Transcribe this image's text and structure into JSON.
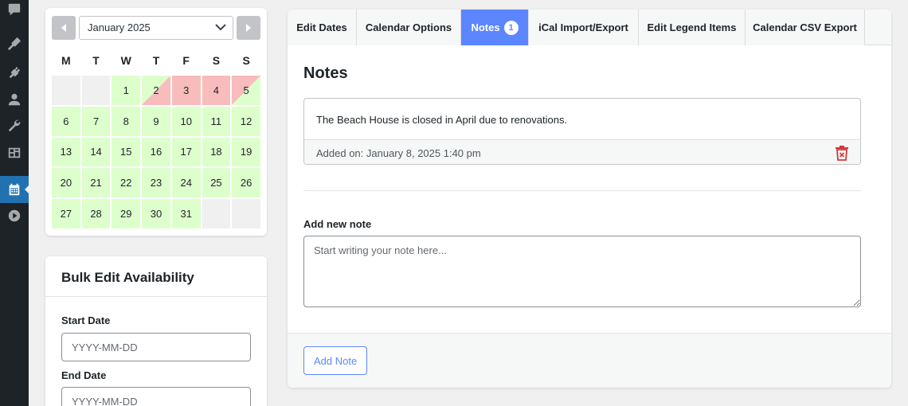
{
  "admin_menu": {
    "icons": [
      "comments-icon",
      "appearance-icon",
      "plugins-icon",
      "users-icon",
      "tools-icon",
      "settings-icon",
      "calendar-icon",
      "media-play-icon"
    ],
    "active": "calendar-icon"
  },
  "calendar": {
    "month_label": "January 2025",
    "weekdays": [
      "M",
      "T",
      "W",
      "T",
      "F",
      "S",
      "S"
    ],
    "days": [
      {
        "label": "",
        "status": "empty"
      },
      {
        "label": "",
        "status": "empty"
      },
      {
        "label": "1",
        "status": "available"
      },
      {
        "label": "2",
        "status": "changeover-in"
      },
      {
        "label": "3",
        "status": "booked"
      },
      {
        "label": "4",
        "status": "booked"
      },
      {
        "label": "5",
        "status": "changeover-out"
      },
      {
        "label": "6",
        "status": "available"
      },
      {
        "label": "7",
        "status": "available"
      },
      {
        "label": "8",
        "status": "available"
      },
      {
        "label": "9",
        "status": "available"
      },
      {
        "label": "10",
        "status": "available"
      },
      {
        "label": "11",
        "status": "available"
      },
      {
        "label": "12",
        "status": "available"
      },
      {
        "label": "13",
        "status": "available"
      },
      {
        "label": "14",
        "status": "available"
      },
      {
        "label": "15",
        "status": "available"
      },
      {
        "label": "16",
        "status": "available"
      },
      {
        "label": "17",
        "status": "available"
      },
      {
        "label": "18",
        "status": "available"
      },
      {
        "label": "19",
        "status": "available"
      },
      {
        "label": "20",
        "status": "available"
      },
      {
        "label": "21",
        "status": "available"
      },
      {
        "label": "22",
        "status": "available"
      },
      {
        "label": "23",
        "status": "available"
      },
      {
        "label": "24",
        "status": "available"
      },
      {
        "label": "25",
        "status": "available"
      },
      {
        "label": "26",
        "status": "available"
      },
      {
        "label": "27",
        "status": "available"
      },
      {
        "label": "28",
        "status": "available"
      },
      {
        "label": "29",
        "status": "available"
      },
      {
        "label": "30",
        "status": "available"
      },
      {
        "label": "31",
        "status": "available"
      },
      {
        "label": "",
        "status": "empty"
      },
      {
        "label": "",
        "status": "empty"
      }
    ]
  },
  "bulk_edit": {
    "title": "Bulk Edit Availability",
    "start_date_label": "Start Date",
    "start_date_placeholder": "YYYY-MM-DD",
    "end_date_label": "End Date",
    "end_date_placeholder": "YYYY-MM-DD"
  },
  "tabs": [
    {
      "label": "Edit Dates",
      "active": false
    },
    {
      "label": "Calendar Options",
      "active": false
    },
    {
      "label": "Notes",
      "active": true,
      "badge": "1"
    },
    {
      "label": "iCal Import/Export",
      "active": false
    },
    {
      "label": "Edit Legend Items",
      "active": false
    },
    {
      "label": "Calendar CSV Export",
      "active": false
    }
  ],
  "notes": {
    "title": "Notes",
    "items": [
      {
        "text": "The Beach House is closed in April due to renovations.",
        "added_on": "Added on: January 8, 2025 1:40 pm"
      }
    ],
    "add_label": "Add new note",
    "textarea_placeholder": "Start writing your note here...",
    "add_button": "Add Note"
  },
  "colors": {
    "accent": "#5b86ff",
    "available": "#ddffcc",
    "booked": "#f9bcbc",
    "admin_active": "#2271b1",
    "delete": "#d63638"
  }
}
